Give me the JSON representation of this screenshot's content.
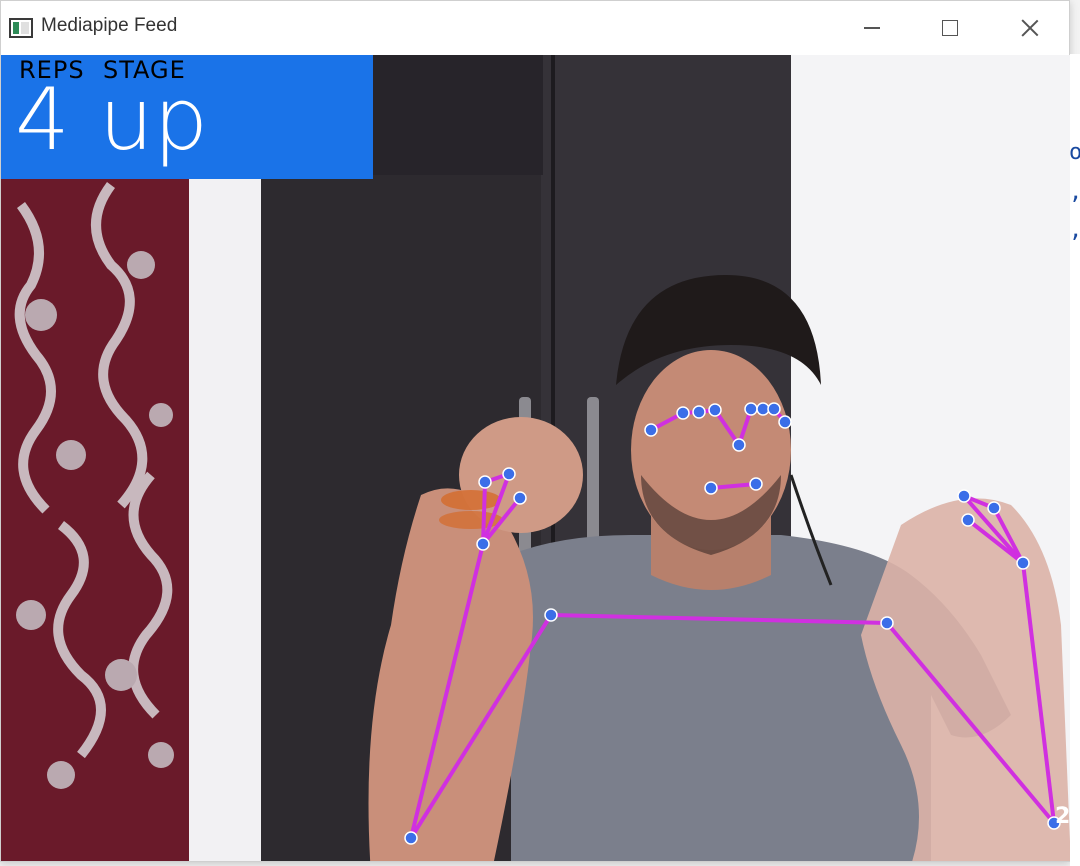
{
  "window": {
    "title": "Mediapipe Feed",
    "controls": {
      "minimize_icon": "minimize-icon",
      "maximize_icon": "maximize-icon",
      "close_icon": "close-icon"
    }
  },
  "overlay": {
    "reps_label": "REPS",
    "stage_label": "STAGE",
    "reps_value": "4",
    "stage_value": "up",
    "background": "#1a73e8",
    "label_color": "#000000",
    "value_color": "#ffffff"
  },
  "pose": {
    "landmark_color": "#3b6ee8",
    "connection_color": "#d030e0"
  },
  "background_window_glyphs": [
    "o",
    ",",
    ","
  ]
}
